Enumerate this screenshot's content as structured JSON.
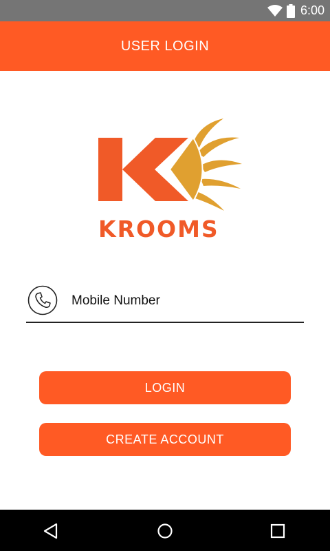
{
  "status_bar": {
    "time": "6:00",
    "icons": [
      "wifi-icon",
      "battery-icon"
    ]
  },
  "app_bar": {
    "title": "USER LOGIN"
  },
  "logo": {
    "brand_text": "KROOMS"
  },
  "form": {
    "mobile_placeholder": "Mobile Number",
    "mobile_value": "",
    "icon": "phone-icon"
  },
  "buttons": {
    "login_label": "LOGIN",
    "create_account_label": "CREATE ACCOUNT"
  },
  "nav": {
    "items": [
      "back-icon",
      "home-icon",
      "recents-icon"
    ]
  },
  "colors": {
    "accent": "#FF5A24",
    "brand_orange": "#F05A28",
    "brand_gold": "#E0A030",
    "status_bar": "#757575",
    "nav_bar": "#000000"
  }
}
